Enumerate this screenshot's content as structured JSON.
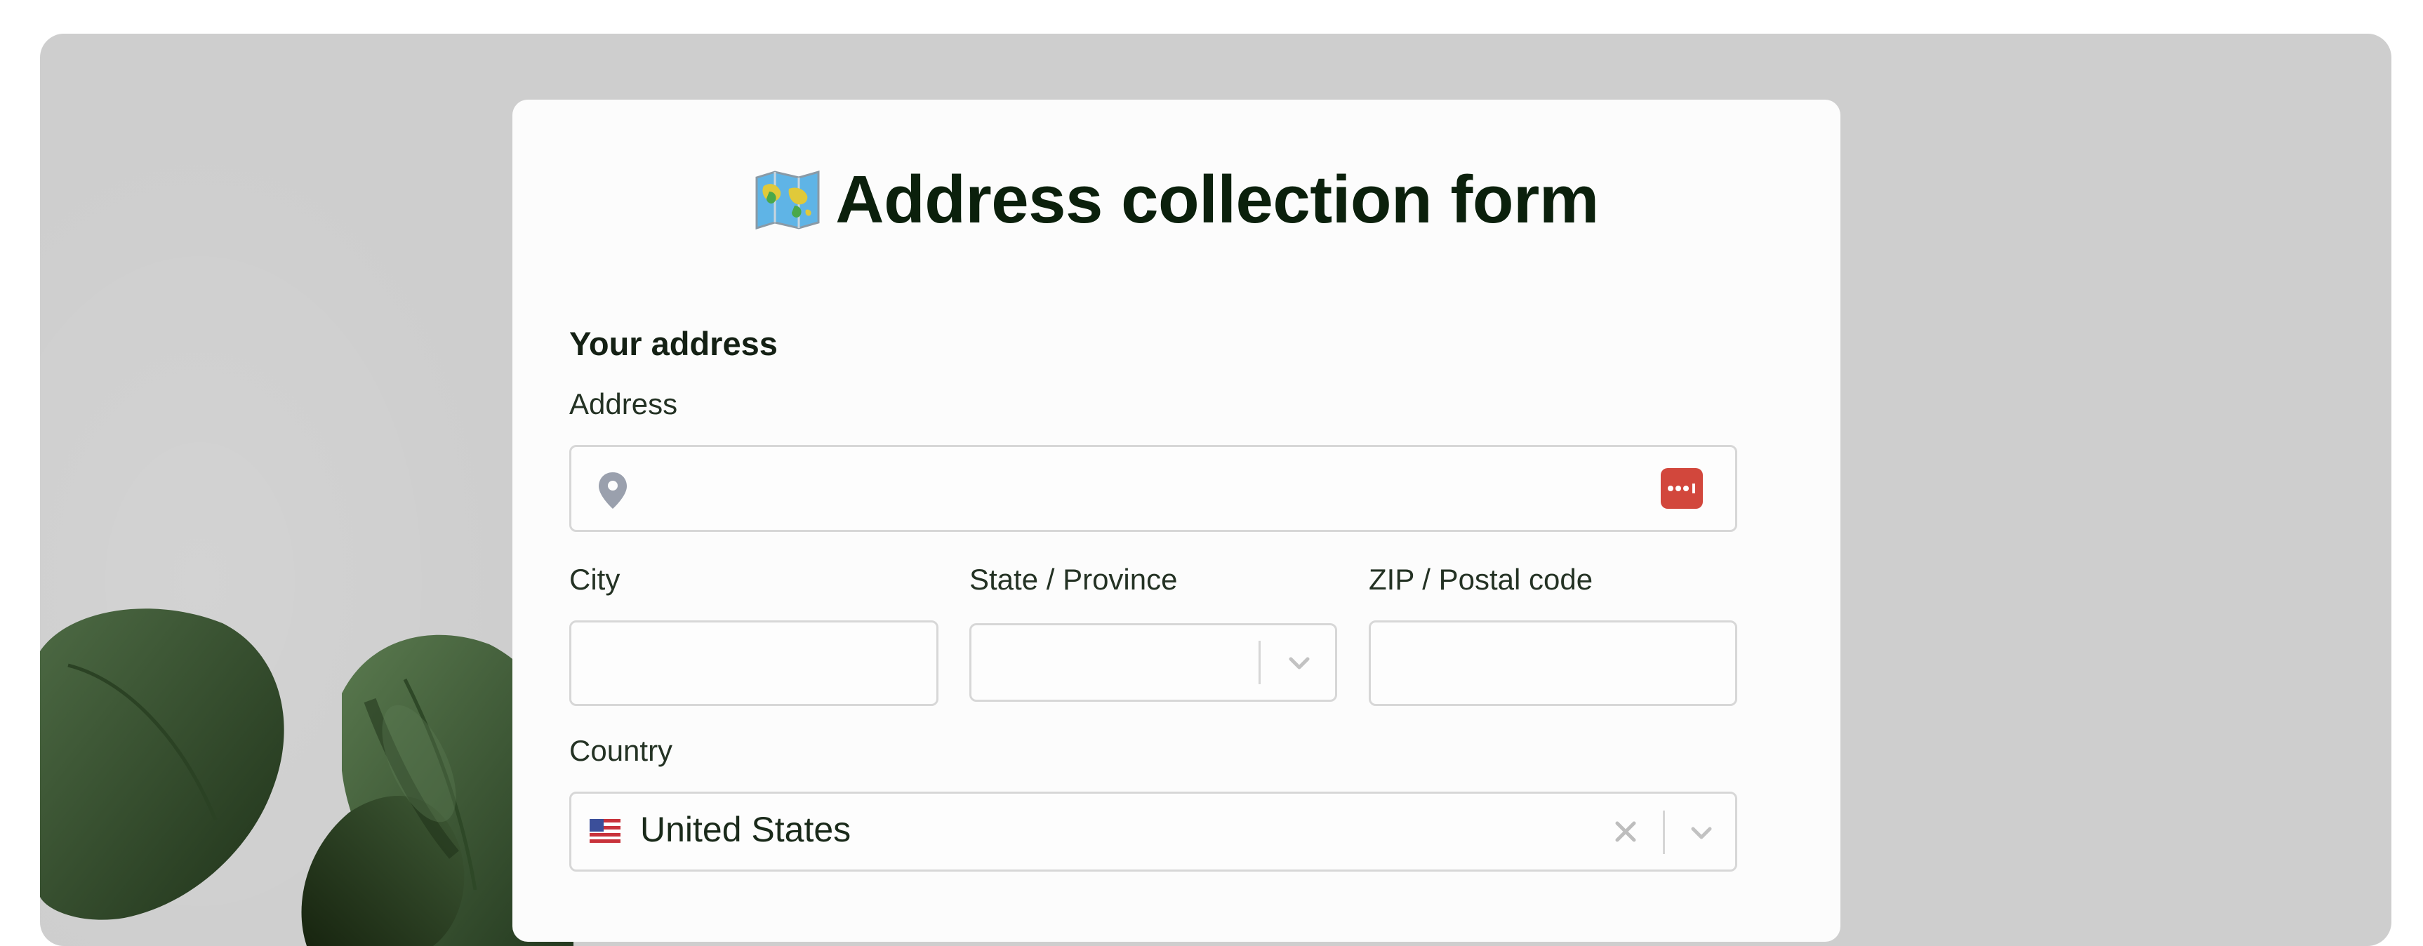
{
  "form": {
    "title": "Address collection form",
    "title_icon": "world-map-icon",
    "section_title": "Your address"
  },
  "fields": {
    "address": {
      "label": "Address",
      "value": "",
      "leading_icon": "map-pin-icon",
      "trailing_icon": "password-manager-icon"
    },
    "city": {
      "label": "City",
      "value": ""
    },
    "state": {
      "label": "State / Province",
      "value": "",
      "trailing_icon": "chevron-down-icon"
    },
    "zip": {
      "label": "ZIP / Postal code",
      "value": ""
    },
    "country": {
      "label": "Country",
      "value": "United States",
      "flag_icon": "us-flag-icon",
      "clear_icon": "close-icon",
      "trailing_icon": "chevron-down-icon"
    }
  },
  "colors": {
    "background": "#cecece",
    "card": "#fcfcfc",
    "title_text": "#0b200c",
    "password_badge": "#d2473c"
  }
}
